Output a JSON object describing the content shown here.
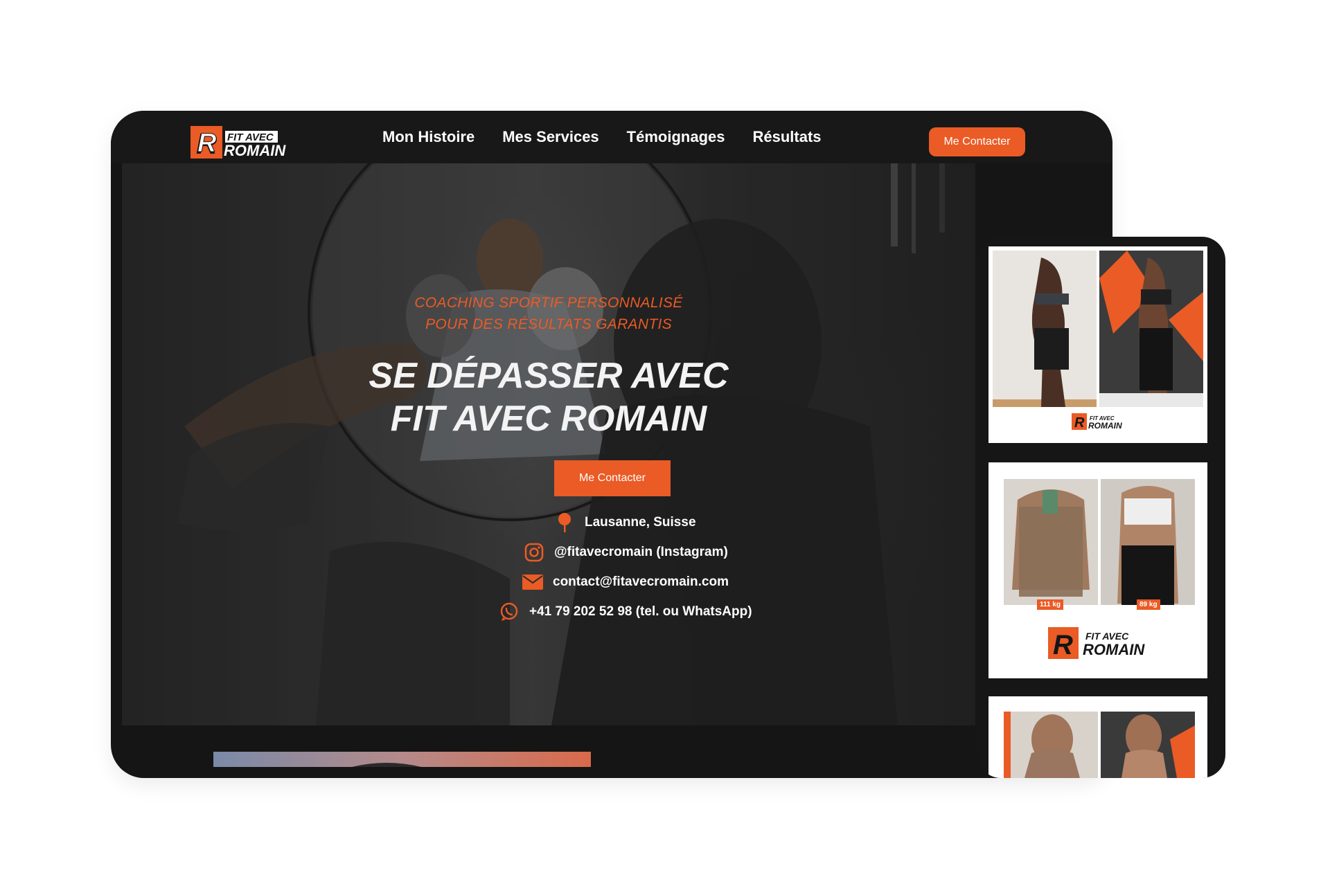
{
  "brand": {
    "logo_line1": "FIT AVEC",
    "logo_line2": "ROMAIN",
    "logo_letter": "R",
    "accent_color": "#ea5b25",
    "dark_color": "#151515"
  },
  "nav": {
    "items": [
      {
        "label": "Mon Histoire"
      },
      {
        "label": "Mes Services"
      },
      {
        "label": "Témoignages"
      },
      {
        "label": "Résultats"
      }
    ],
    "cta_label": "Me Contacter"
  },
  "hero": {
    "subtitle_line1": "COACHING SPORTIF PERSONNALISÉ",
    "subtitle_line2": "POUR DES RÉSULTATS GARANTIS",
    "title_line1": "SE DÉPASSER AVEC",
    "title_line2": "FIT AVEC ROMAIN",
    "cta_label": "Me Contacter"
  },
  "contacts": [
    {
      "icon": "map-pin-icon",
      "text": "Lausanne, Suisse"
    },
    {
      "icon": "instagram-icon",
      "text": "@fitavecromain (Instagram)"
    },
    {
      "icon": "mail-icon",
      "text": "contact@fitavecromain.com"
    },
    {
      "icon": "whatsapp-icon",
      "text": "+41 79 202 52 98 (tel. ou WhatsApp)"
    }
  ],
  "results": {
    "weight_before": "111 kg",
    "weight_after": "89 kg"
  }
}
